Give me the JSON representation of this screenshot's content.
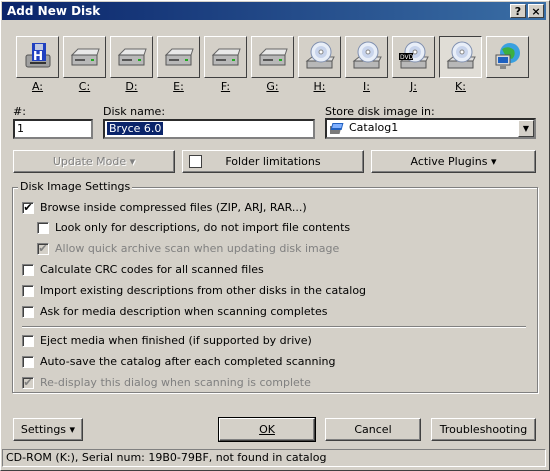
{
  "window": {
    "title": "Add New Disk"
  },
  "titlebar_buttons": {
    "help": "?",
    "close": "×"
  },
  "drives": [
    {
      "letter": "A:",
      "icon": "floppy-drive-icon"
    },
    {
      "letter": "C:",
      "icon": "hard-drive-icon"
    },
    {
      "letter": "D:",
      "icon": "hard-drive-icon"
    },
    {
      "letter": "E:",
      "icon": "hard-drive-icon"
    },
    {
      "letter": "F:",
      "icon": "hard-drive-icon"
    },
    {
      "letter": "G:",
      "icon": "hard-drive-icon"
    },
    {
      "letter": "H:",
      "icon": "cd-drive-icon"
    },
    {
      "letter": "I:",
      "icon": "cd-drive-icon"
    },
    {
      "letter": "J:",
      "icon": "dvd-drive-icon",
      "badge": "DVD"
    },
    {
      "letter": "K:",
      "icon": "cd-drive-icon",
      "selected": true
    },
    {
      "letter": "",
      "icon": "network-icon"
    }
  ],
  "form": {
    "number_label": "#:",
    "number_value": "1",
    "disk_name_label": "Disk name:",
    "disk_name_value": "Bryce 6.0",
    "store_label": "Store disk image in:",
    "store_value": "Catalog1"
  },
  "buttons": {
    "update_mode": "Update Mode",
    "folder_limitations": "Folder limitations",
    "active_plugins": "Active Plugins",
    "settings": "Settings",
    "ok": "OK",
    "cancel": "Cancel",
    "troubleshooting": "Troubleshooting"
  },
  "settings_group": {
    "title": "Disk Image Settings",
    "options": [
      {
        "label": "Browse inside compressed files (ZIP, ARJ, RAR...)",
        "checked": true,
        "disabled": false
      },
      {
        "label": "Look only for descriptions, do not import file contents",
        "checked": false,
        "disabled": false
      },
      {
        "label": "Allow quick archive scan when updating disk image",
        "checked": true,
        "disabled": true
      },
      {
        "label": "Calculate CRC codes for all scanned files",
        "checked": false,
        "disabled": false
      },
      {
        "label": "Import existing descriptions from other disks in the catalog",
        "checked": false,
        "disabled": false
      },
      {
        "label": "Ask for media description when scanning completes",
        "checked": false,
        "disabled": false
      },
      {
        "label": "Eject media when finished (if supported by drive)",
        "checked": false,
        "disabled": false
      },
      {
        "label": "Auto-save the catalog after each completed scanning",
        "checked": false,
        "disabled": false
      },
      {
        "label": "Re-display this dialog when scanning is complete",
        "checked": true,
        "disabled": true
      }
    ]
  },
  "status": {
    "text": "CD-ROM (K:), Serial num: 19B0-79BF, not found in catalog"
  }
}
